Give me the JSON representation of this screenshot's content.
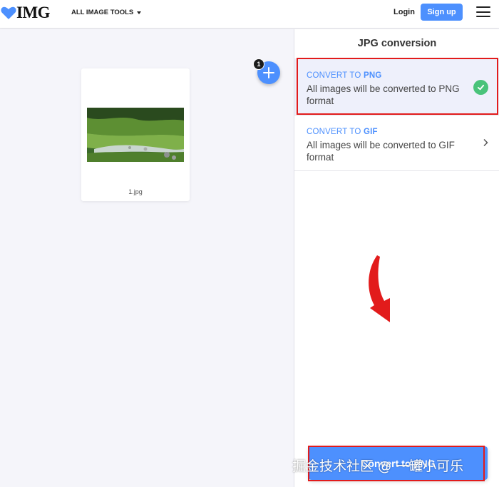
{
  "header": {
    "logo_text": "IMG",
    "tools_menu_label": "ALL IMAGE TOOLS",
    "login_label": "Login",
    "signup_label": "Sign up"
  },
  "workspace": {
    "file_name": "1.jpg",
    "file_count_badge": "1"
  },
  "panel": {
    "title": "JPG conversion",
    "options": [
      {
        "head_prefix": "CONVERT TO ",
        "format": "PNG",
        "description": "All images will be converted to PNG format",
        "selected": true
      },
      {
        "head_prefix": "CONVERT TO ",
        "format": "GIF",
        "description": "All images will be converted to GIF format",
        "selected": false
      }
    ],
    "convert_button_label": "Convert to PNG"
  },
  "watermark": "掘金技术社区 @ 一罐小可乐",
  "colors": {
    "accent": "#4d90fe",
    "success": "#49c37a",
    "annotation_red": "#e21b1b"
  },
  "icons": [
    "heart-logo-icon",
    "caret-down-icon",
    "hamburger-icon",
    "plus-icon",
    "check-icon",
    "chevron-right-icon",
    "curved-arrow-icon"
  ]
}
